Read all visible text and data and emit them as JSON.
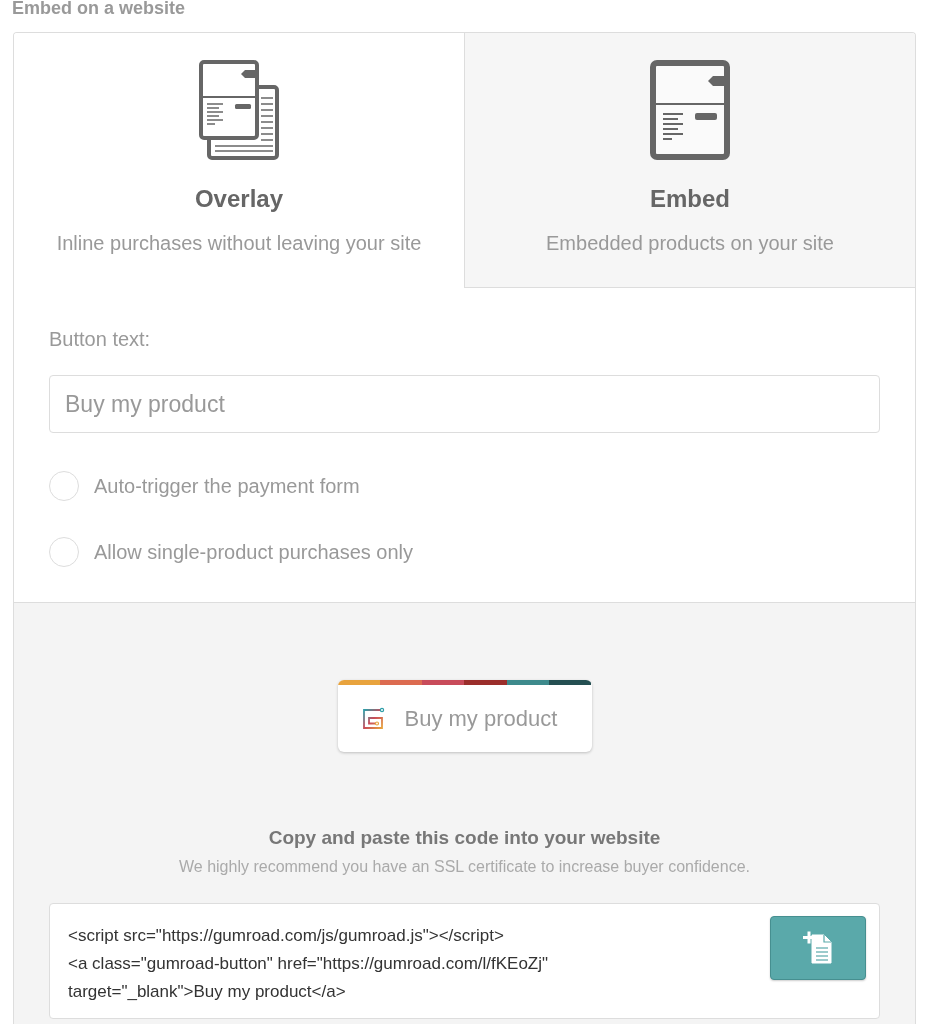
{
  "section_title": "Embed on a website",
  "tabs": [
    {
      "kind": "overlay",
      "label": "Overlay",
      "description": "Inline purchases without leaving your site",
      "selected": true
    },
    {
      "kind": "embed",
      "label": "Embed",
      "description": "Embedded products on your site",
      "selected": false
    }
  ],
  "button_text_field": {
    "label": "Button text:",
    "value": "Buy my product"
  },
  "options": [
    {
      "label": "Auto-trigger the payment form",
      "checked": false
    },
    {
      "label": "Allow single-product purchases only",
      "checked": false
    }
  ],
  "preview_button": {
    "label": "Buy my product"
  },
  "code_section": {
    "title": "Copy and paste this code into your website",
    "subtitle": "We highly recommend you have an SSL certificate to increase buyer confidence.",
    "code_lines": [
      "<script src=\"https://gumroad.com/js/gumroad.js\"></script>",
      "<a class=\"gumroad-button\" href=\"https://gumroad.com/l/fKEoZj\"",
      "target=\"_blank\">Buy my product</a>"
    ]
  }
}
